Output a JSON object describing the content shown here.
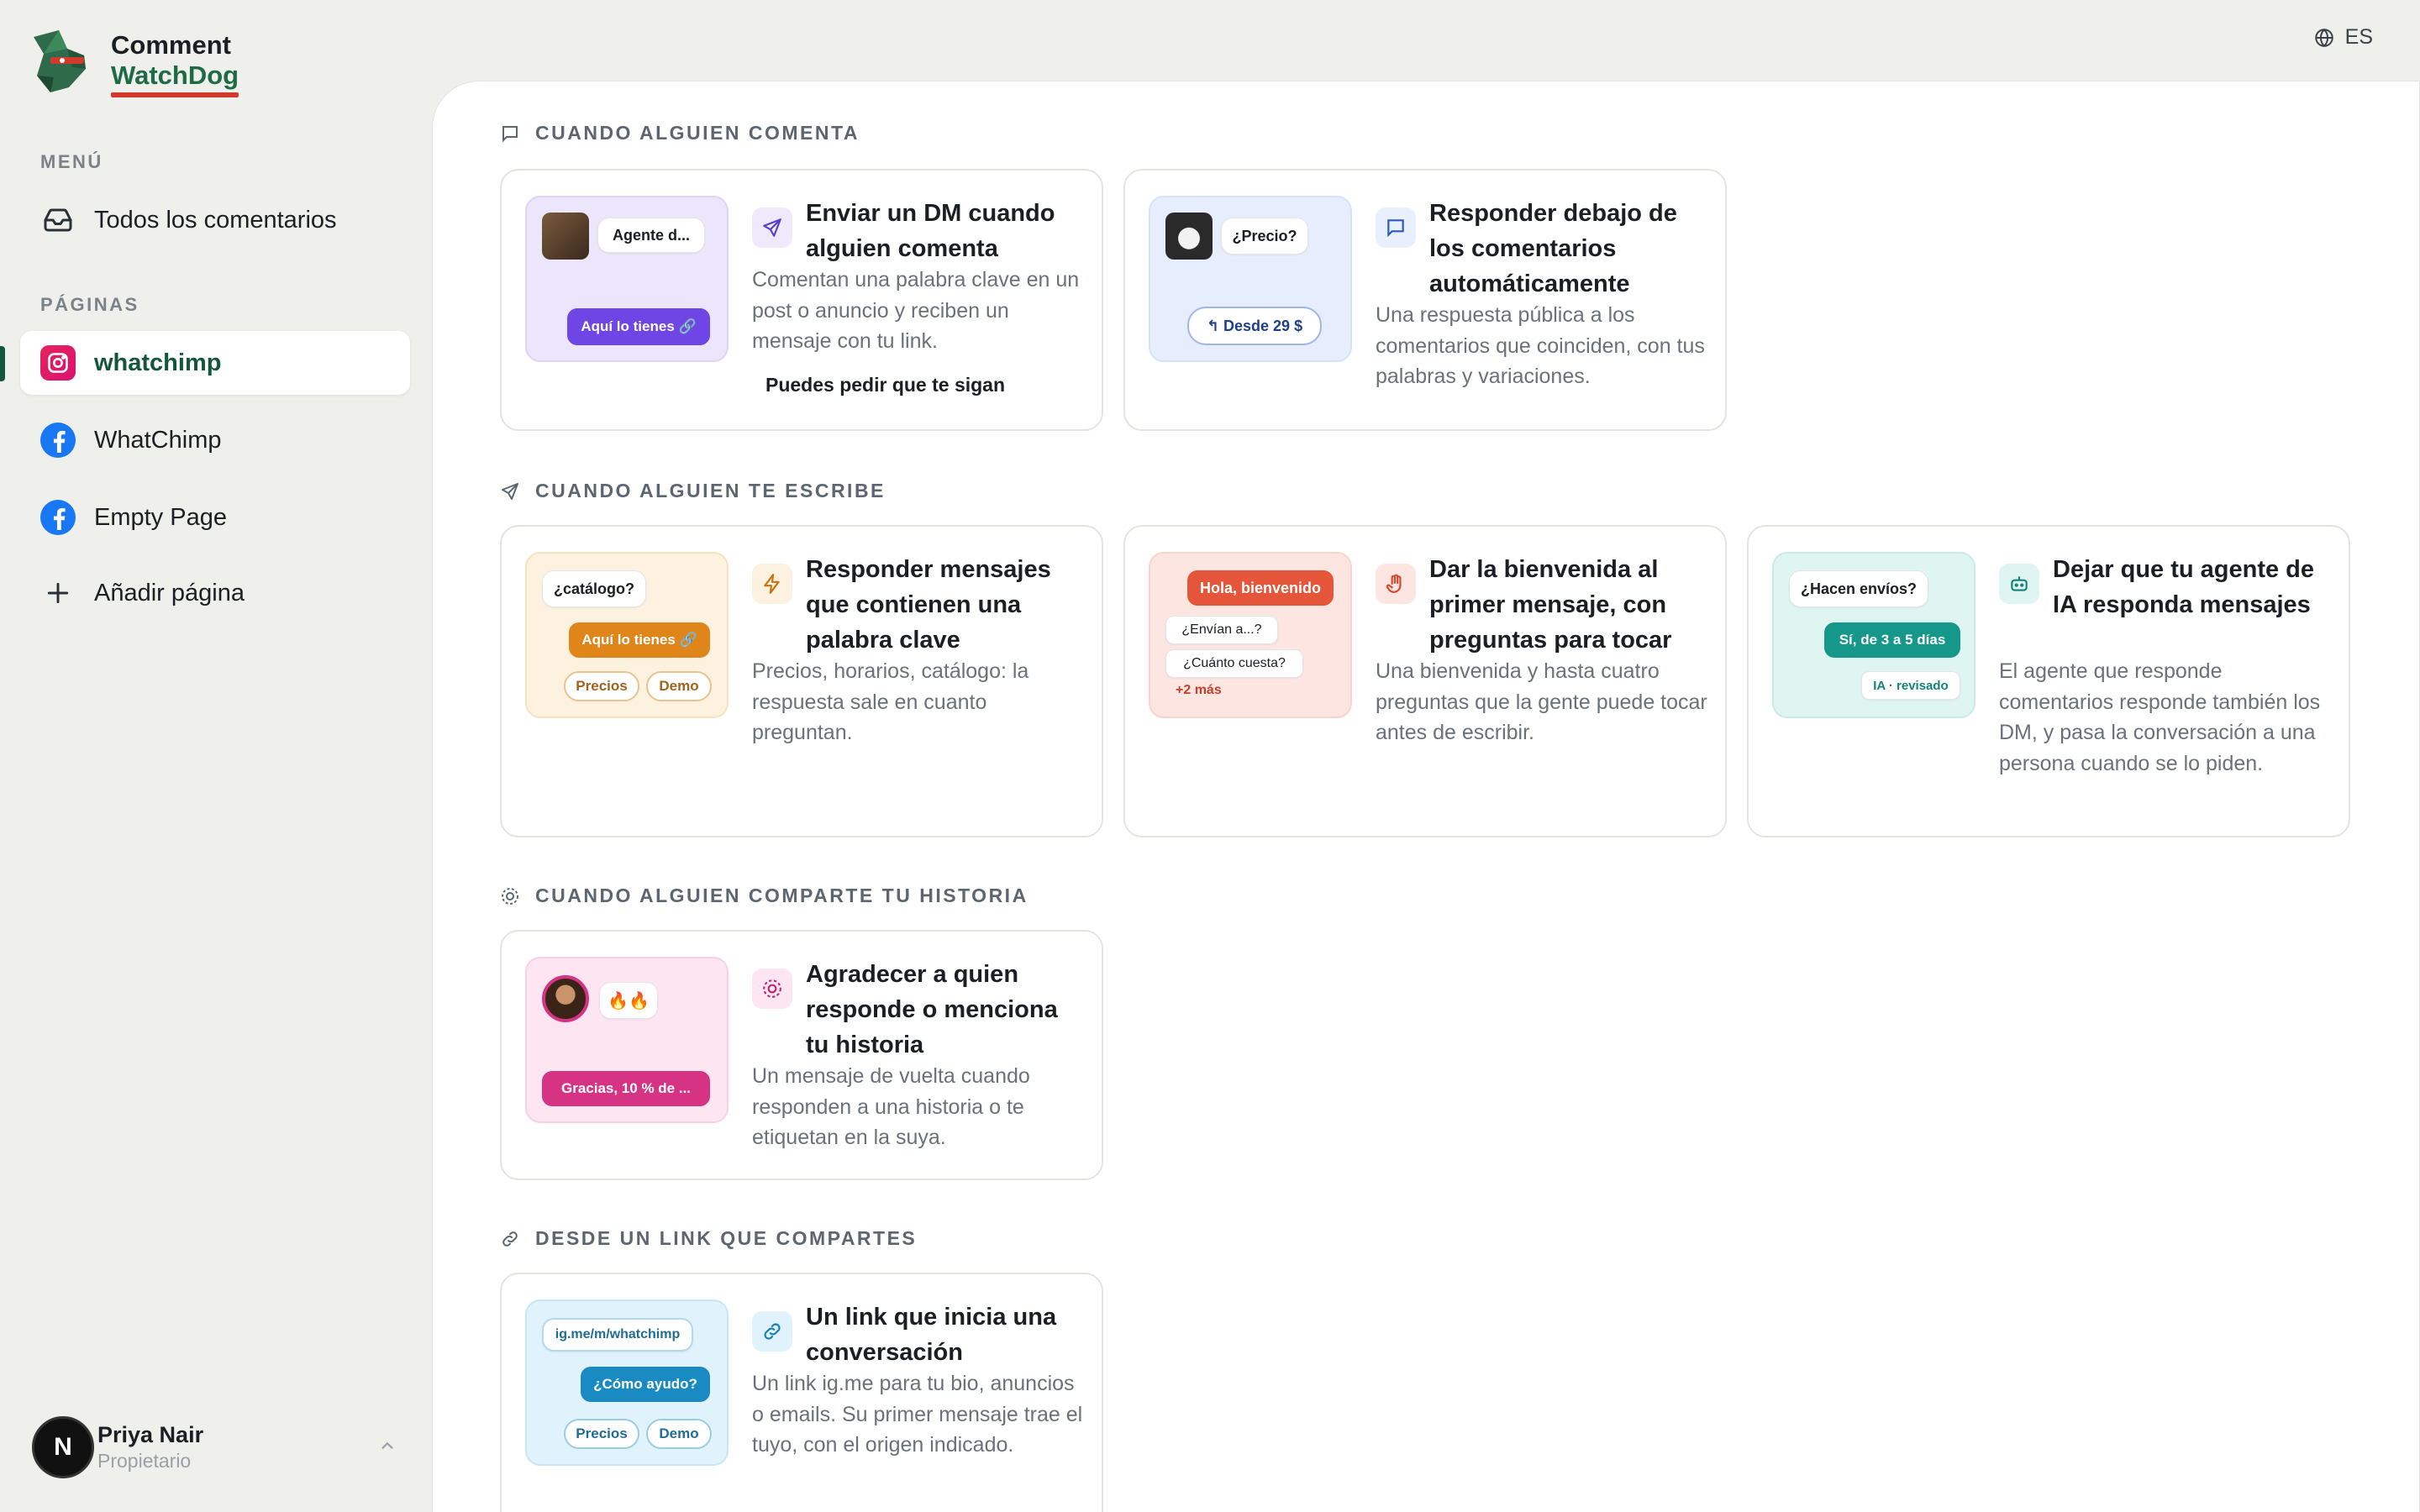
{
  "brand": {
    "line1": "Comment",
    "line2": "WatchDog"
  },
  "language": {
    "code": "ES"
  },
  "sidebar": {
    "menu_heading": "MENÚ",
    "all_comments": "Todos los comentarios",
    "pages_heading": "PÁGINAS",
    "pages": [
      {
        "label": "whatchimp",
        "platform": "instagram",
        "active": true
      },
      {
        "label": "WhatChimp",
        "platform": "facebook",
        "active": false
      },
      {
        "label": "Empty Page",
        "platform": "facebook",
        "active": false
      }
    ],
    "add_page": "Añadir página",
    "user": {
      "initial": "N",
      "name": "Priya Nair",
      "role": "Propietario"
    }
  },
  "sections": [
    {
      "title": "CUANDO ALGUIEN COMENTA",
      "icon": "comment-icon",
      "cards": [
        {
          "title": "Enviar un DM cuando alguien comenta",
          "desc": "Comentan una palabra clave en un post o anuncio y reciben un mensaje con tu link.",
          "note": "Puedes pedir que te sigan",
          "icon": "send-icon",
          "thumb": {
            "bubble": "Agente d...",
            "button": "Aquí lo tienes"
          }
        },
        {
          "title": "Responder debajo de los comentarios automáticamente",
          "desc": "Una respuesta pública a los comentarios que coinciden, con tus palabras y variaciones.",
          "icon": "reply-comment-icon",
          "thumb": {
            "bubble": "¿Precio?",
            "reply": "Desde 29 $"
          }
        }
      ]
    },
    {
      "title": "CUANDO ALGUIEN TE ESCRIBE",
      "icon": "send-icon",
      "cards": [
        {
          "title": "Responder mensajes que contienen una palabra clave",
          "desc": "Precios, horarios, catálogo: la respuesta sale en cuanto preguntan.",
          "icon": "bolt-icon",
          "thumb": {
            "bubble": "¿catálogo?",
            "button": "Aquí lo tienes",
            "chips": [
              "Precios",
              "Demo"
            ]
          }
        },
        {
          "title": "Dar la bienvenida al primer mensaje, con preguntas para tocar",
          "desc": "Una bienvenida y hasta cuatro preguntas que la gente puede tocar antes de escribir.",
          "icon": "hand-icon",
          "thumb": {
            "greeting": "Hola, bienvenido",
            "q1": "¿Envían a...?",
            "q2": "¿Cuánto cuesta?",
            "more": "+2 más"
          }
        },
        {
          "title": "Dejar que tu agente de IA responda mensajes",
          "desc": "El agente que responde comentarios responde también los DM, y pasa la conversación a una persona cuando se lo piden.",
          "icon": "bot-icon",
          "thumb": {
            "bubble": "¿Hacen envíos?",
            "answer": "Sí, de 3 a 5 días",
            "tag": "IA · revisado"
          }
        }
      ]
    },
    {
      "title": "CUANDO ALGUIEN COMPARTE TU HISTORIA",
      "icon": "story-icon",
      "cards": [
        {
          "title": "Agradecer a quien responde o menciona tu historia",
          "desc": "Un mensaje de vuelta cuando responden a una historia o te etiquetan en la suya.",
          "icon": "story-icon",
          "thumb": {
            "reaction": "🔥🔥",
            "button": "Gracias, 10 % de ..."
          }
        }
      ]
    },
    {
      "title": "DESDE UN LINK QUE COMPARTES",
      "icon": "link-icon",
      "cards": [
        {
          "title": "Un link que inicia una conversación",
          "desc": "Un link ig.me para tu bio, anuncios o emails. Su primer mensaje trae el tuyo, con el origen indicado.",
          "icon": "link-icon",
          "thumb": {
            "url": "ig.me/m/whatchimp",
            "button": "¿Cómo ayudo?",
            "chips": [
              "Precios",
              "Demo"
            ]
          }
        }
      ]
    }
  ]
}
